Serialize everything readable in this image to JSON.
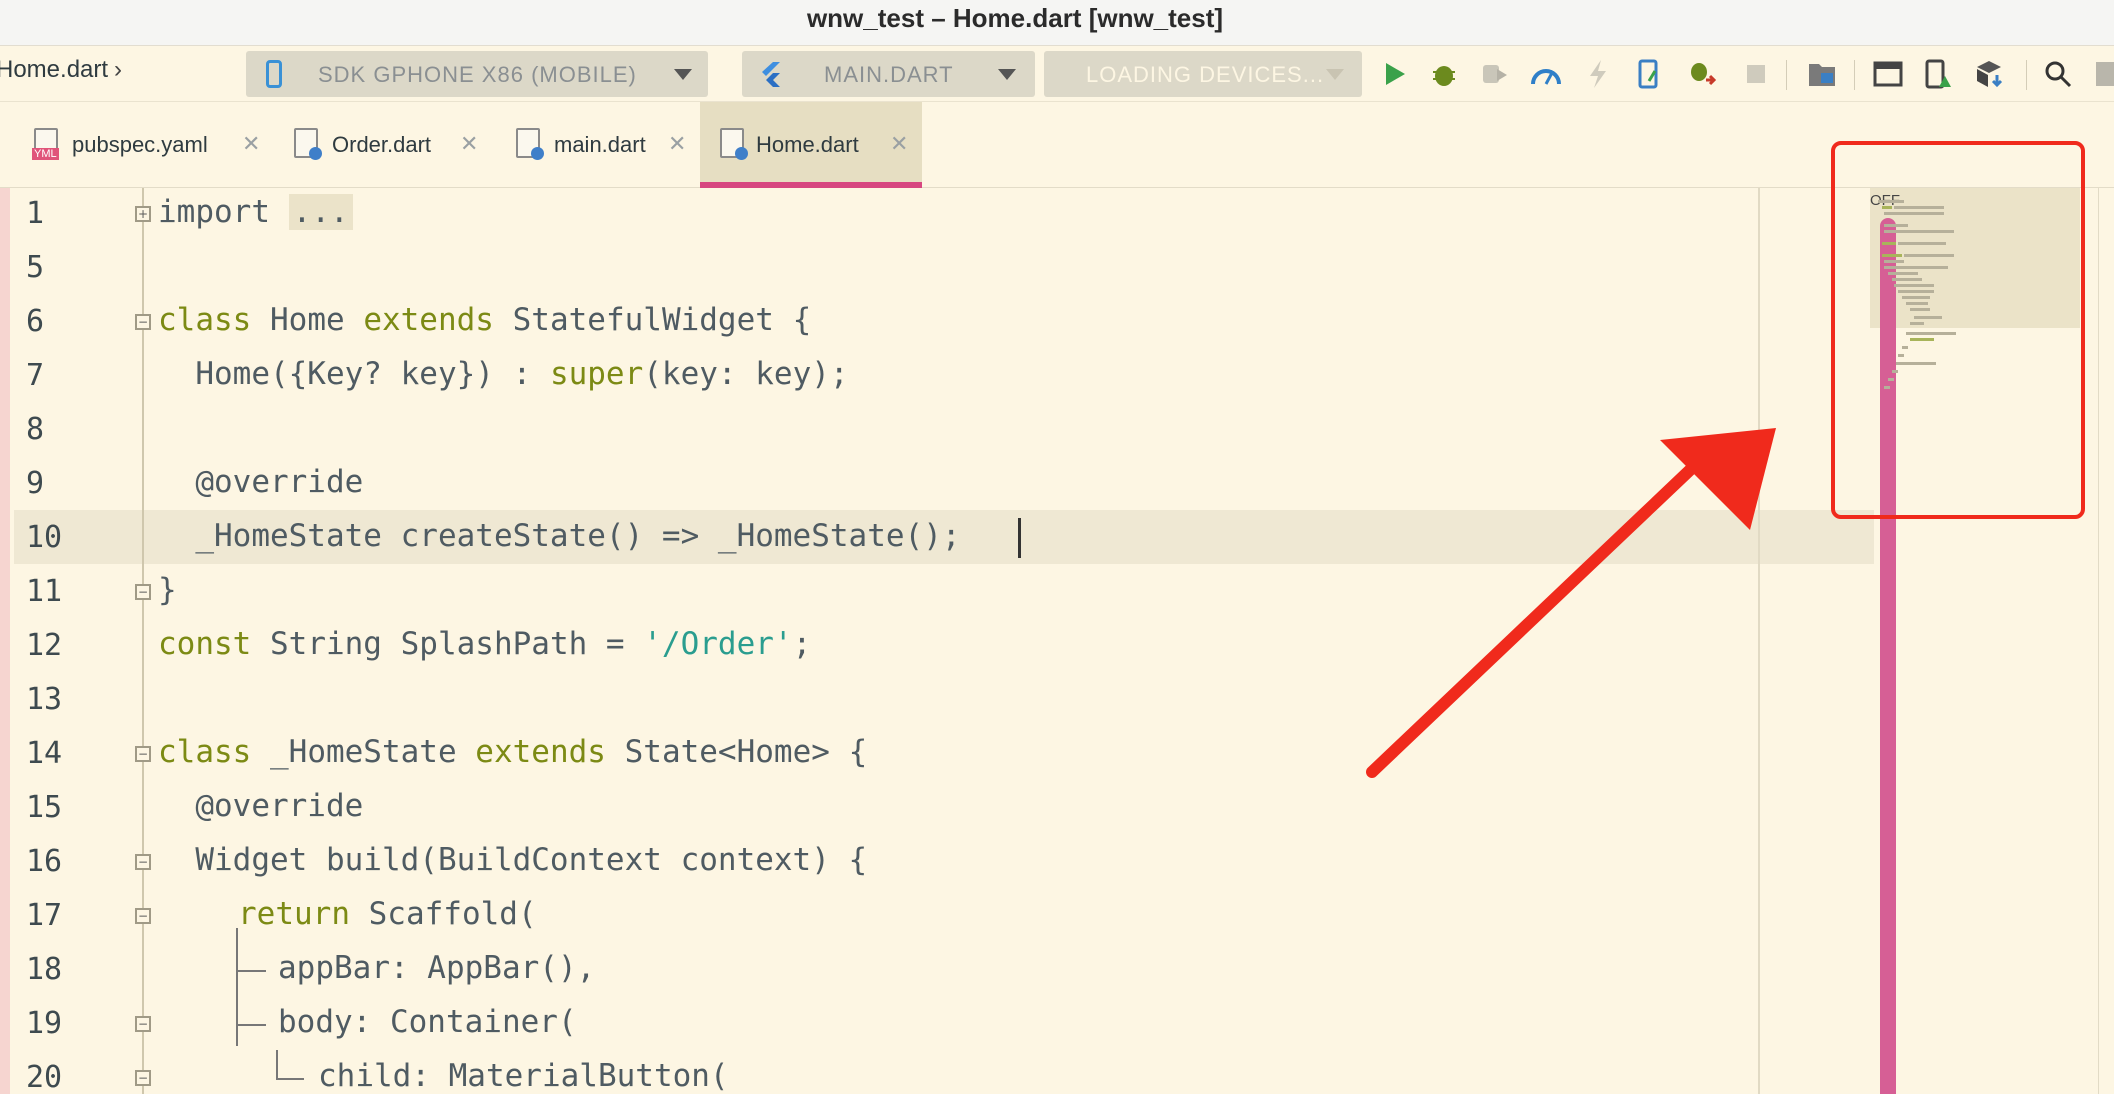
{
  "window": {
    "title": "wnw_test – Home.dart [wnw_test]"
  },
  "toolbar": {
    "breadcrumb": "Home.dart",
    "device_selector": "SDK GPHONE X86 (MOBILE)",
    "config_selector": "MAIN.DART",
    "devices_selector": "LOADING DEVICES..."
  },
  "tabs": [
    {
      "label": "pubspec.yaml",
      "icon": "yaml-file-icon",
      "yml_tag": "YML"
    },
    {
      "label": "Order.dart",
      "icon": "dart-file-icon"
    },
    {
      "label": "main.dart",
      "icon": "dart-file-icon"
    },
    {
      "label": "Home.dart",
      "icon": "dart-file-icon",
      "active": true
    }
  ],
  "editor": {
    "line_numbers": [
      "1",
      "5",
      "6",
      "7",
      "8",
      "9",
      "10",
      "11",
      "12",
      "13",
      "14",
      "15",
      "16",
      "17",
      "18",
      "19",
      "20"
    ],
    "current_line": "10",
    "code": {
      "l1_kw": "import",
      "l1_fold": "...",
      "l6_a": "class",
      "l6_b": " Home ",
      "l6_c": "extends",
      "l6_d": " StatefulWidget {",
      "l7_a": "  Home({Key? key}) : ",
      "l7_b": "super",
      "l7_c": "(key: key);",
      "l9": "  @override",
      "l10": "  _HomeState createState() => _HomeState();",
      "l11": "}",
      "l12_a": "const",
      "l12_b": " String SplashPath = ",
      "l12_c": "'/Order'",
      "l12_d": ";",
      "l14_a": "class",
      "l14_b": " _HomeState ",
      "l14_c": "extends",
      "l14_d": " State<Home> {",
      "l15": "  @override",
      "l16": "  Widget build(BuildContext context) {",
      "l17_a": "return",
      "l17_b": " Scaffold(",
      "l18": "appBar: AppBar(),",
      "l19": "body: Container(",
      "l20": "child: MaterialButton("
    }
  },
  "minimap": {
    "toggle_label": "OFF"
  },
  "colors": {
    "background": "#fdf6e3",
    "keyword": "#7c8a14",
    "string": "#2a9d8f",
    "scrollbar": "#d65f95",
    "annotation": "#f02a1c",
    "tab_underline": "#d74780"
  }
}
